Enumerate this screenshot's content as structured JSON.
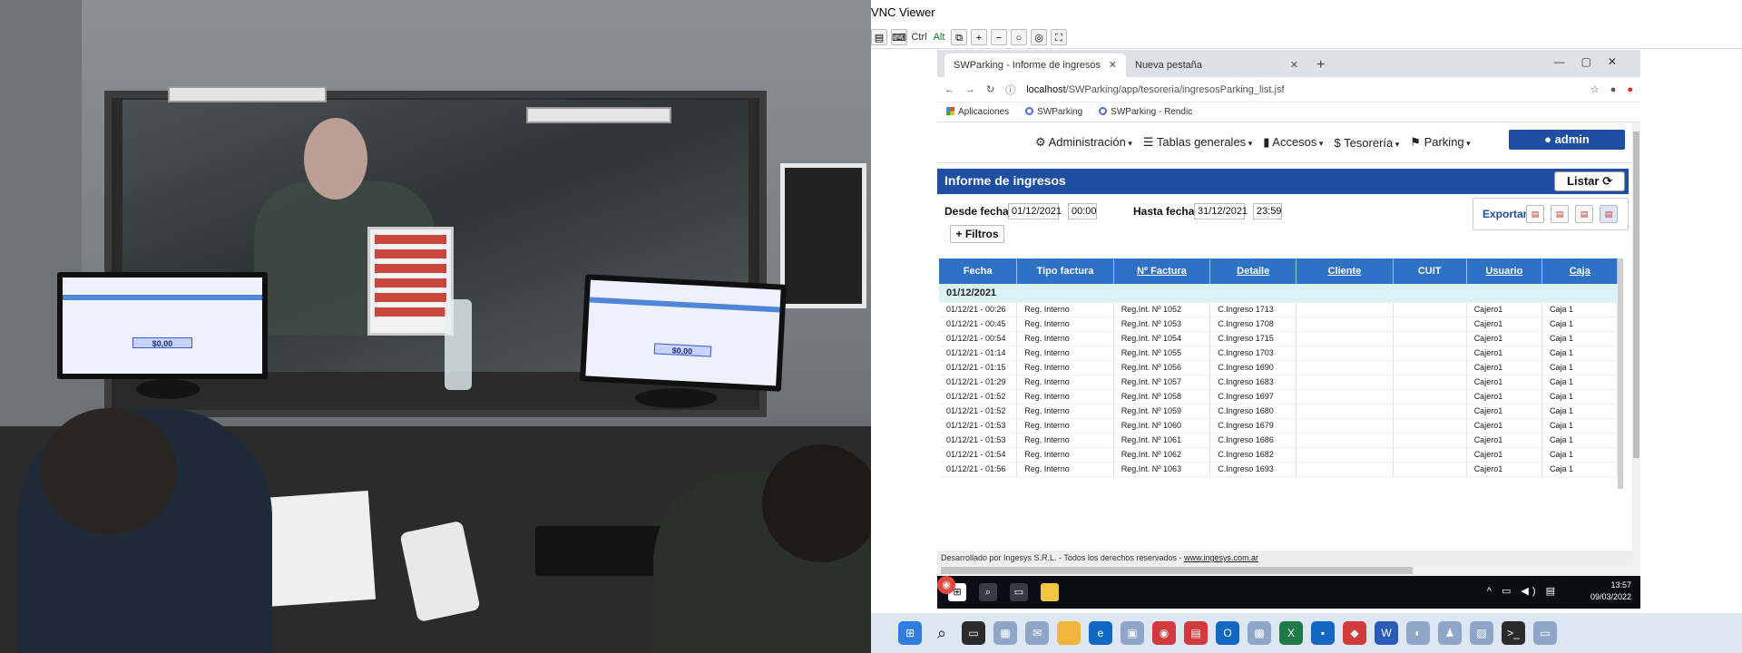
{
  "vnc": {
    "title": "VNC Viewer",
    "toolbar": {
      "ctrl": "Ctrl",
      "alt": "Alt"
    }
  },
  "browser": {
    "tabs": [
      {
        "label": "SWParking - Informe de ingresos"
      },
      {
        "label": "Nueva pestaña"
      }
    ],
    "url_host": "localhost",
    "url_path": "/SWParking/app/tesoreria/ingresosParking_list.jsf",
    "bookmarks": [
      "Aplicaciones",
      "SWParking",
      "SWParking - Rendic"
    ]
  },
  "nav": {
    "items": [
      "Administración",
      "Tablas generales",
      "Accesos",
      "Tesorería",
      "Parking"
    ],
    "user": "admin"
  },
  "report": {
    "title": "Informe de ingresos",
    "listar": "Listar",
    "desde_label": "Desde fecha:",
    "desde_fecha": "01/12/2021",
    "desde_hora": "00:00",
    "hasta_label": "Hasta fecha:",
    "hasta_fecha": "31/12/2021",
    "hasta_hora": "23:59",
    "required_mark": "*",
    "exportar": "Exportar:",
    "filtros": "+ Filtros"
  },
  "table": {
    "columns": [
      "Fecha",
      "Tipo factura",
      "Nº Factura",
      "Detalle",
      "Cliente",
      "CUIT",
      "Usuario",
      "Caja"
    ],
    "group": "01/12/2021",
    "rows": [
      [
        "01/12/21 - 00:26",
        "Reg. Interno",
        "Reg.Int. Nº 1052",
        "C.Ingreso 1713",
        "",
        "",
        "Cajero1",
        "Caja 1"
      ],
      [
        "01/12/21 - 00:45",
        "Reg. Interno",
        "Reg.Int. Nº 1053",
        "C.Ingreso 1708",
        "",
        "",
        "Cajero1",
        "Caja 1"
      ],
      [
        "01/12/21 - 00:54",
        "Reg. Interno",
        "Reg.Int. Nº 1054",
        "C.Ingreso 1715",
        "",
        "",
        "Cajero1",
        "Caja 1"
      ],
      [
        "01/12/21 - 01:14",
        "Reg. Interno",
        "Reg.Int. Nº 1055",
        "C.Ingreso 1703",
        "",
        "",
        "Cajero1",
        "Caja 1"
      ],
      [
        "01/12/21 - 01:15",
        "Reg. Interno",
        "Reg.Int. Nº 1056",
        "C.Ingreso 1690",
        "",
        "",
        "Cajero1",
        "Caja 1"
      ],
      [
        "01/12/21 - 01:29",
        "Reg. Interno",
        "Reg.Int. Nº 1057",
        "C.Ingreso 1683",
        "",
        "",
        "Cajero1",
        "Caja 1"
      ],
      [
        "01/12/21 - 01:52",
        "Reg. Interno",
        "Reg.Int. Nº 1058",
        "C.Ingreso 1697",
        "",
        "",
        "Cajero1",
        "Caja 1"
      ],
      [
        "01/12/21 - 01:52",
        "Reg. Interno",
        "Reg.Int. Nº 1059",
        "C.Ingreso 1680",
        "",
        "",
        "Cajero1",
        "Caja 1"
      ],
      [
        "01/12/21 - 01:53",
        "Reg. Interno",
        "Reg.Int. Nº 1060",
        "C.Ingreso 1679",
        "",
        "",
        "Cajero1",
        "Caja 1"
      ],
      [
        "01/12/21 - 01:53",
        "Reg. Interno",
        "Reg.Int. Nº 1061",
        "C.Ingreso 1686",
        "",
        "",
        "Cajero1",
        "Caja 1"
      ],
      [
        "01/12/21 - 01:54",
        "Reg. Interno",
        "Reg.Int. Nº 1062",
        "C.Ingreso 1682",
        "",
        "",
        "Cajero1",
        "Caja 1"
      ],
      [
        "01/12/21 - 01:56",
        "Reg. Interno",
        "Reg.Int. Nº 1063",
        "C.Ingreso 1693",
        "",
        "",
        "Cajero1",
        "Caja 1"
      ]
    ]
  },
  "footer": {
    "text": "Desarrollado por Ingesys S.R.L. - Todos los derechos reservados - ",
    "link": "www.ingesys.com.ar"
  },
  "remote_taskbar": {
    "time": "13:57",
    "date": "09/03/2022"
  },
  "photo": {
    "monitor_amount": "$0,00"
  },
  "colors": {
    "primary": "#1f4fa3",
    "table_header": "#2e72c6",
    "group_row": "#d9f3f7"
  }
}
